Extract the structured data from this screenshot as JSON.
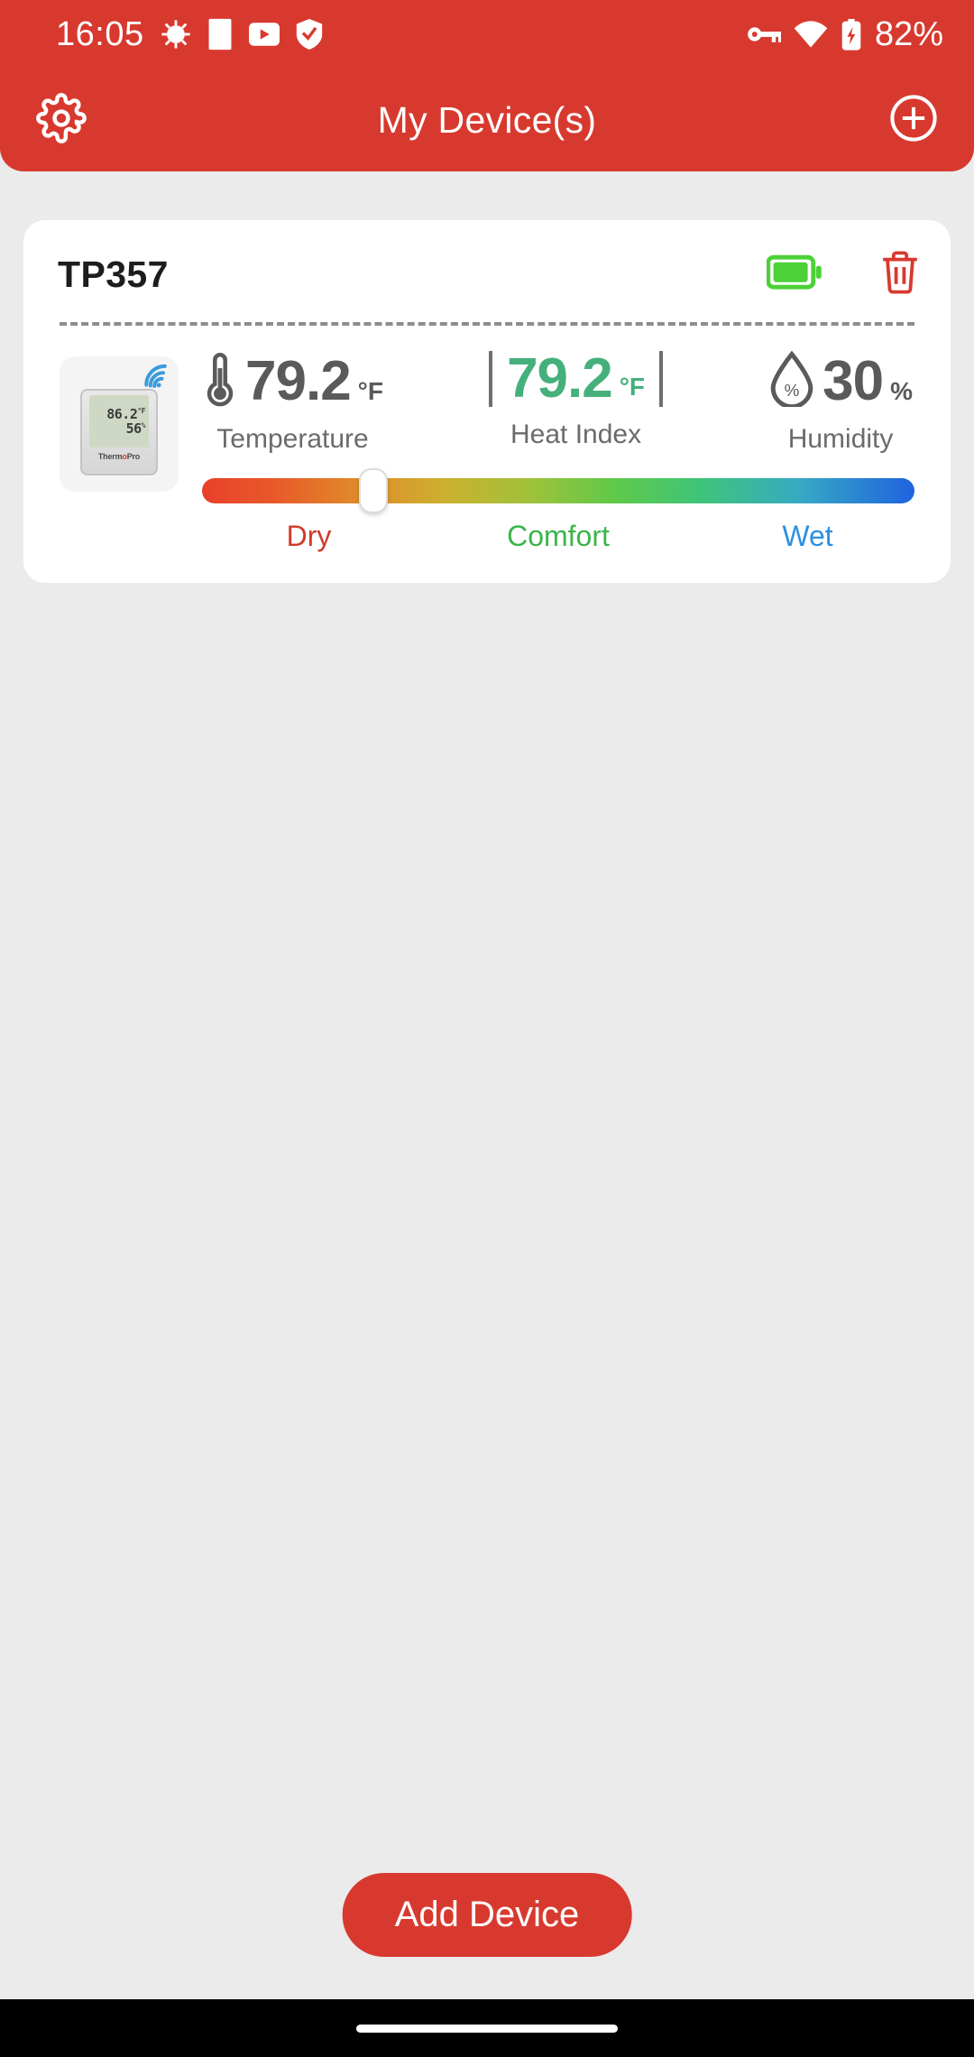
{
  "status_bar": {
    "time": "16:05",
    "battery_text": "82%",
    "icons_left": [
      "android-debug-icon",
      "app-square-icon",
      "youtube-icon",
      "shield-check-icon"
    ],
    "icons_right": [
      "vpn-key-icon",
      "wifi-icon",
      "battery-charging-icon"
    ]
  },
  "app_bar": {
    "title": "My Device(s)",
    "settings_icon": "gear-icon",
    "add_icon": "plus-circle-icon",
    "background_color": "#d8392f"
  },
  "device_card": {
    "name": "TP357",
    "battery_icon": "battery-full-icon",
    "battery_color": "#4cd137",
    "delete_icon": "trash-icon",
    "delete_color": "#d8392f",
    "thumbnail": {
      "wifi_icon": "wifi-signal-icon",
      "lcd_temperature": "86.2",
      "lcd_temperature_unit": "°F",
      "lcd_humidity": "56",
      "lcd_humidity_unit": "%",
      "brand_name": "ThermoPro"
    },
    "metrics": [
      {
        "icon": "thermometer-icon",
        "value": "79.2",
        "unit": "°F",
        "label": "Temperature",
        "color": "#5a5a5a"
      },
      {
        "icon": "none",
        "value": "79.2",
        "unit": "°F",
        "label": "Heat Index",
        "color": "#45b07c"
      },
      {
        "icon": "humidity-drop-icon",
        "value": "30",
        "unit": "%",
        "label": "Humidity",
        "color": "#5a5a5a"
      }
    ],
    "comfort_slider": {
      "thumb_percent": 24,
      "labels": [
        {
          "text": "Dry",
          "color": "#d03a2b",
          "position_percent": 15
        },
        {
          "text": "Comfort",
          "color": "#3bb54a",
          "position_percent": 50
        },
        {
          "text": "Wet",
          "color": "#2d8fe0",
          "position_percent": 85
        }
      ]
    }
  },
  "add_device_button": {
    "label": "Add Device"
  }
}
